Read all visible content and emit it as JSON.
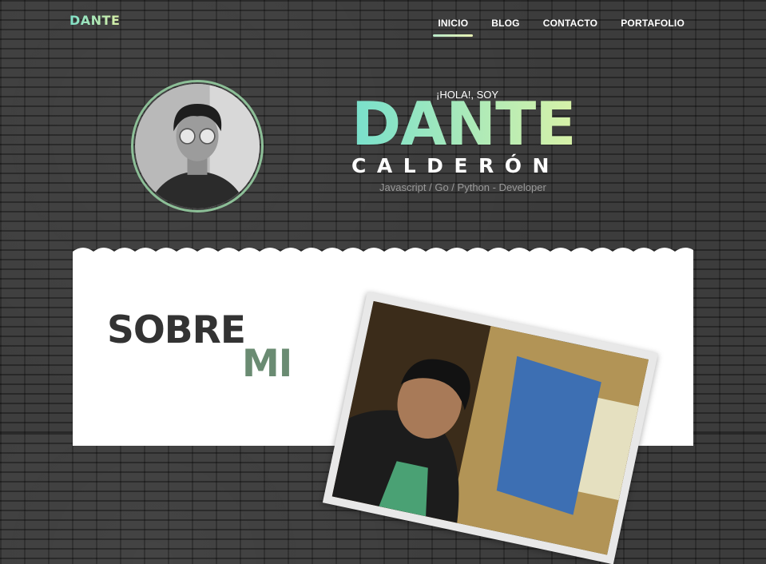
{
  "header": {
    "logo": "DANTE",
    "nav": [
      {
        "label": "INICIO",
        "active": true
      },
      {
        "label": "BLOG",
        "active": false
      },
      {
        "label": "CONTACTO",
        "active": false
      },
      {
        "label": "PORTAFOLIO",
        "active": false
      }
    ]
  },
  "hero": {
    "greeting": "¡HOLA!, SOY",
    "first_name": "DANTE",
    "last_name": "CALDERÓN",
    "role": "Javascript / Go / Python - Developer"
  },
  "about": {
    "title_line1": "SOBRE",
    "title_line2": "MI"
  },
  "colors": {
    "accent_start": "#78e0cc",
    "accent_end": "#d8f2a8",
    "about_mi": "#6a8b72",
    "avatar_ring": "#8cbf97"
  }
}
